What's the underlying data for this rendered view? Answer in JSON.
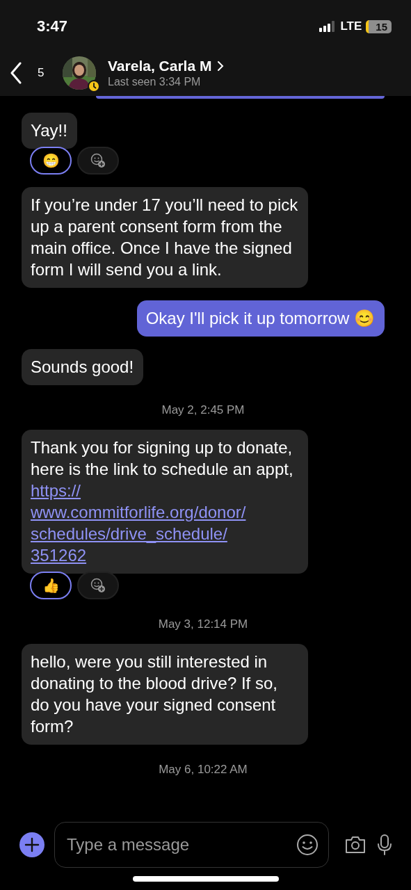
{
  "status_bar": {
    "time": "3:47",
    "network": "LTE",
    "battery": "15"
  },
  "header": {
    "back_count": "5",
    "name": "Varela, Carla M",
    "subtitle": "Last seen 3:34 PM",
    "away": true
  },
  "messages": [
    {
      "kind": "incoming",
      "text": "Yay!!",
      "reactions": [
        {
          "emoji": "😁",
          "selected": true
        }
      ]
    },
    {
      "kind": "incoming",
      "text": "If you’re under 17 you’ll need to pick up a parent consent form from the main office. Once I have the signed form I will send you a link."
    },
    {
      "kind": "outgoing",
      "text": "Okay I'll pick it up tomorrow 😊"
    },
    {
      "kind": "incoming",
      "text": "Sounds good!"
    },
    {
      "kind": "date",
      "text": "May 2, 2:45 PM"
    },
    {
      "kind": "incoming",
      "text": "Thank you for signing up to donate, here is the link to schedule an appt,",
      "link_lines": [
        "https://",
        "www.commitforlife.org/donor/",
        "schedules/drive_schedule/",
        "351262"
      ],
      "reactions": [
        {
          "emoji": "👍",
          "selected": true
        }
      ]
    },
    {
      "kind": "date",
      "text": "May 3, 12:14 PM"
    },
    {
      "kind": "incoming",
      "text": "hello, were you still interested in donating to the blood drive? If so, do you have your signed consent form?"
    },
    {
      "kind": "date",
      "text": "May 6, 10:22 AM"
    }
  ],
  "composer": {
    "placeholder": "Type a message"
  }
}
